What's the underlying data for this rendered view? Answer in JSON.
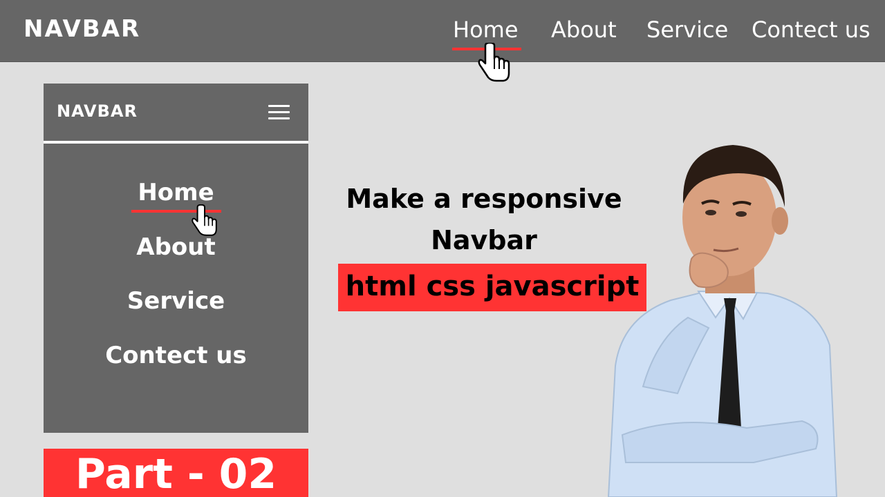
{
  "top_nav": {
    "logo": "NAVBAR",
    "links": [
      "Home",
      "About",
      "Service",
      "Contect us"
    ],
    "active": "Home"
  },
  "mobile_nav": {
    "logo": "NAVBAR",
    "menu_icon": "hamburger-menu-icon",
    "links": [
      "Home",
      "About",
      "Service",
      "Contect us"
    ],
    "active": "Home"
  },
  "part_label": "Part - 02",
  "headline": {
    "line1": "Make a responsive",
    "line2": "Navbar"
  },
  "tag": "html css javascript",
  "colors": {
    "navbar_bg": "#666666",
    "page_bg": "#dfdfdf",
    "accent": "#ff3333",
    "text_light": "#ffffff",
    "text_dark": "#000000"
  },
  "icons": [
    "pointer-hand-cursor-icon",
    "hamburger-menu-icon"
  ]
}
